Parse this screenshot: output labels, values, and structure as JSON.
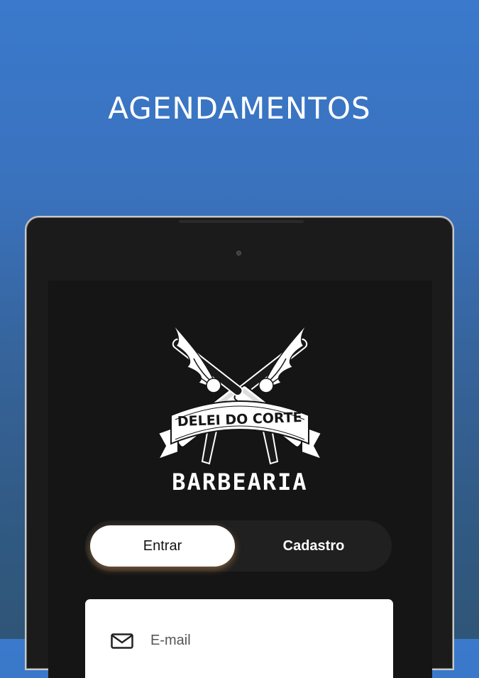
{
  "promo": {
    "title": "AGENDAMENTOS"
  },
  "logo": {
    "brand_name": "DELEI DO CORTE",
    "brand_subtitle": "BARBEARIA"
  },
  "auth_tabs": {
    "login_label": "Entrar",
    "signup_label": "Cadastro",
    "selected": "Entrar"
  },
  "login_form": {
    "email_placeholder": "E-mail",
    "email_value": ""
  },
  "colors": {
    "background_top": "#3a79cc",
    "background_bottom": "#2f5677",
    "device_body": "#1b1b1b",
    "screen": "#151515",
    "tab_active_bg": "#ffffff",
    "tab_glow": "#c98c50"
  }
}
